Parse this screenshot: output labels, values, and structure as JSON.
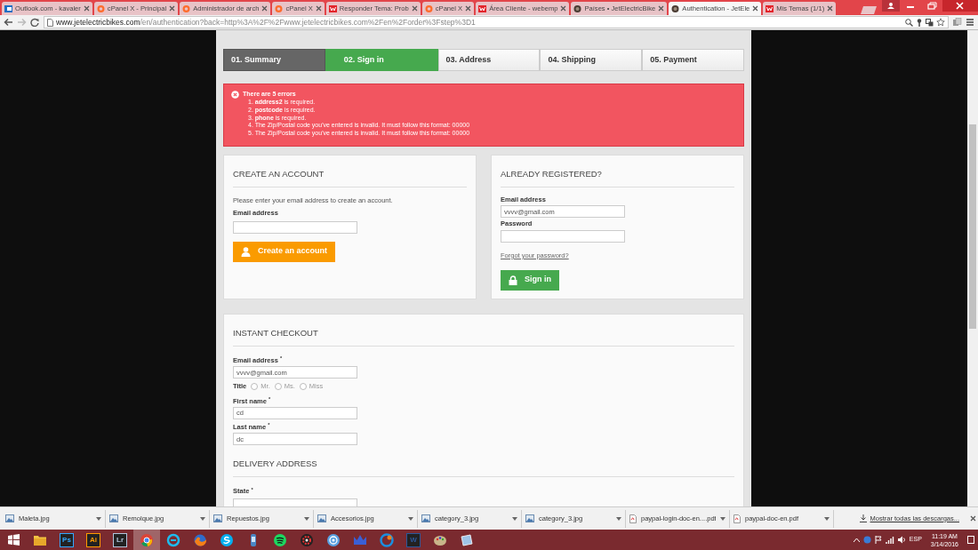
{
  "browser": {
    "tabs": [
      {
        "title": "Outlook.com - kavaler",
        "kind": "mail",
        "selected": false
      },
      {
        "title": "cPanel X - Principal",
        "kind": "cpanel",
        "selected": false
      },
      {
        "title": "Administrador de arch",
        "kind": "cpanel",
        "selected": false
      },
      {
        "title": "cPanel X",
        "kind": "cpanel",
        "selected": false
      },
      {
        "title": "Responder Tema: Prob",
        "kind": "w",
        "selected": false
      },
      {
        "title": "cPanel X",
        "kind": "cpanel",
        "selected": false
      },
      {
        "title": "Área Cliente - webemp",
        "kind": "w",
        "selected": false
      },
      {
        "title": "Países • JetElectricBike",
        "kind": "site",
        "selected": false
      },
      {
        "title": "Authentication - JetEle",
        "kind": "site",
        "selected": true
      },
      {
        "title": "Mis Temas (1/1)",
        "kind": "w",
        "selected": false
      }
    ],
    "url_host": "www.jetelectricbikes.com",
    "url_path": "/en/authentication?back=http%3A%2F%2Fwww.jetelectricbikes.com%2Fen%2Forder%3Fstep%3D1"
  },
  "steps": [
    {
      "label": "01. Summary",
      "kind": "done"
    },
    {
      "label": "02. Sign in",
      "kind": "current"
    },
    {
      "label": "03. Address",
      "kind": "todo"
    },
    {
      "label": "04. Shipping",
      "kind": "todo"
    },
    {
      "label": "05. Payment",
      "kind": "todo"
    }
  ],
  "errors": {
    "title": "There are 5 errors",
    "items": [
      "1. **address2** is required.",
      "2. **postcode** is required.",
      "3. **phone** is required.",
      "4. The Zip/Postal code you've entered is invalid. It must follow this format: 00000",
      "5. The Zip/Postal code you've entered is invalid. It must follow this format: 00000"
    ]
  },
  "create_account": {
    "heading": "CREATE AN ACCOUNT",
    "intro": "Please enter your email address to create an account.",
    "email_label": "Email address",
    "button": "Create an account"
  },
  "registered": {
    "heading": "ALREADY REGISTERED?",
    "email_label": "Email address",
    "email_value": "vvvv@gmail.com",
    "password_label": "Password",
    "forgot_link": "Forgot your password?",
    "button": "Sign in"
  },
  "instant_checkout": {
    "heading": "INSTANT CHECKOUT",
    "email_label": "Email address $^{*}$",
    "email_value": "vvvv@gmail.com",
    "title_label": "Title",
    "title_options": [
      {
        "label": "Mr.",
        "selected": false
      },
      {
        "label": "Ms.",
        "selected": false
      },
      {
        "label": "Miss",
        "selected": false
      }
    ],
    "first_name_label": "First name $^{*}$",
    "first_name_value": "cd",
    "last_name_label": "Last name $^{*}$",
    "last_name_value": "dc",
    "delivery_heading": "DELIVERY ADDRESS",
    "state_label": "State $^{*}$"
  },
  "downloads": {
    "items": [
      {
        "name": "Maleta.jpg",
        "kind": "image"
      },
      {
        "name": "Remolque.jpg",
        "kind": "image"
      },
      {
        "name": "Repuestos.jpg",
        "kind": "image"
      },
      {
        "name": "Accesorios.jpg",
        "kind": "image"
      },
      {
        "name": "category_3.jpg",
        "kind": "image"
      },
      {
        "name": "category_3.jpg",
        "kind": "image"
      },
      {
        "name": "paypal-login-doc-en....pdf",
        "kind": "pdf"
      },
      {
        "name": "paypal-doc-en.pdf",
        "kind": "pdf"
      }
    ],
    "show_all": "Mostrar todas las descargas..."
  },
  "taskbar": {
    "apps": [
      {
        "kind": "folder",
        "selected": false
      },
      {
        "kind": "badge",
        "label": "Ps",
        "color": "#31a8ff",
        "selected": false
      },
      {
        "kind": "badge",
        "label": "Ai",
        "color": "#ff9a00",
        "selected": false
      },
      {
        "kind": "badge",
        "label": "Lr",
        "color": "#b2c4dc",
        "selected": false
      },
      {
        "kind": "chrome",
        "selected": true
      },
      {
        "kind": "ie",
        "selected": false
      },
      {
        "kind": "firefox",
        "selected": false
      },
      {
        "kind": "skype",
        "selected": false
      },
      {
        "kind": "bottle",
        "selected": false
      },
      {
        "kind": "spotify",
        "selected": false
      },
      {
        "kind": "gear",
        "selected": false
      },
      {
        "kind": "target",
        "selected": false
      },
      {
        "kind": "crown",
        "selected": false
      },
      {
        "kind": "swirl",
        "selected": false
      },
      {
        "kind": "badge",
        "label": "W",
        "color": "#2b579a",
        "selected": false
      },
      {
        "kind": "palette",
        "selected": false
      },
      {
        "kind": "window",
        "selected": false
      }
    ],
    "language": "ESP",
    "time": "11:19 AM",
    "date": "3/14/2016"
  }
}
